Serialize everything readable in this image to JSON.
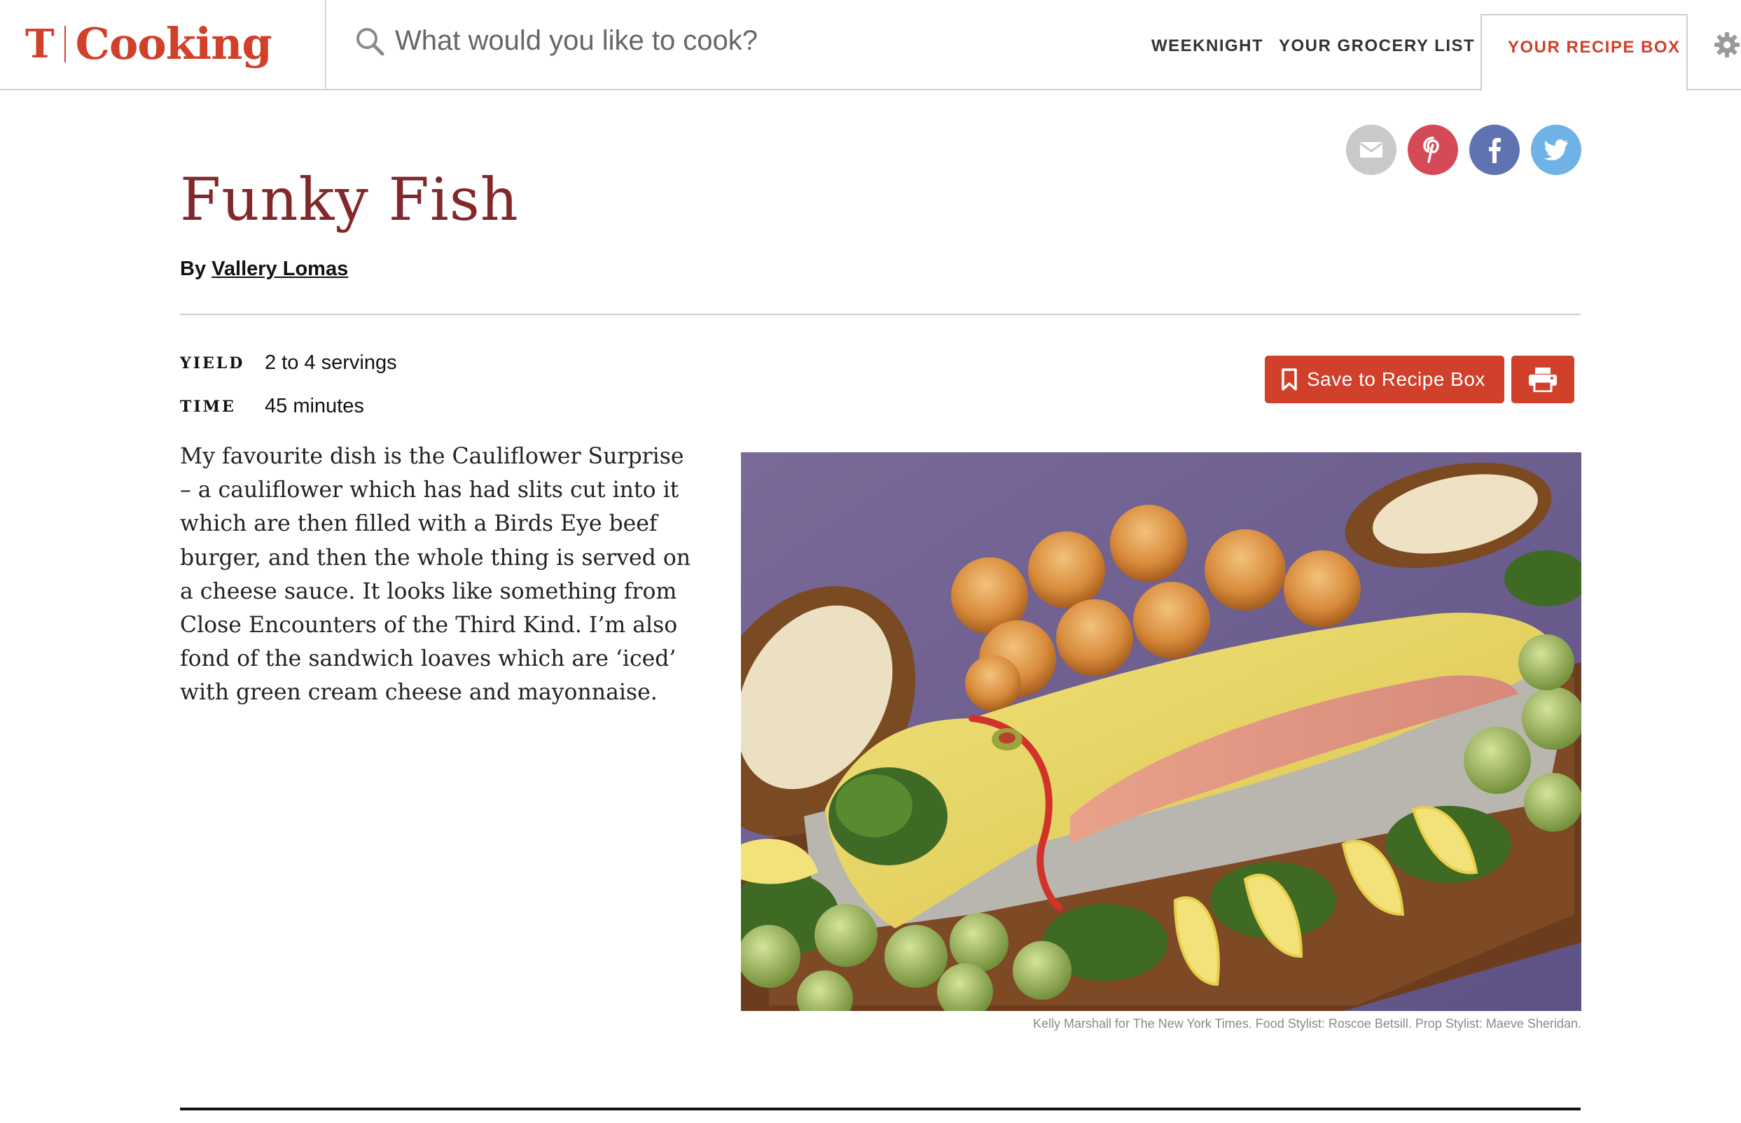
{
  "header": {
    "logo_text": "Cooking",
    "logo_mark": "T",
    "search_placeholder": "What would you like to cook?",
    "nav": {
      "weeknight": "WEEKNIGHT",
      "grocery": "YOUR GROCERY LIST",
      "recipe_box": "YOUR RECIPE BOX"
    }
  },
  "share": {
    "icons": [
      "mail-icon",
      "pinterest-icon",
      "facebook-icon",
      "twitter-icon"
    ]
  },
  "recipe": {
    "title": "Funky Fish",
    "by_prefix": "By",
    "author": "Vallery Lomas",
    "yield_label": "YIELD",
    "yield_value": "2 to 4 servings",
    "time_label": "TIME",
    "time_value": "45 minutes",
    "intro": "My favourite dish is the Cauliflower Surprise – a cauliflower which has had slits cut into it which are then filled with a Birds Eye beef burger, and then the whole thing is served on a cheese sauce. It looks like something from Close Encounters of the Third Kind. I’m also fond of the sandwich loaves which are ‘iced’ with green cream cheese and mayonnaise.",
    "save_button": "Save to Recipe Box",
    "photo_caption": "Kelly Marshall for The New York Times. Food Stylist: Roscoe Betsill. Prop Stylist: Maeve Sheridan."
  },
  "colors": {
    "brand": "#d0402a",
    "title": "#80282a"
  }
}
